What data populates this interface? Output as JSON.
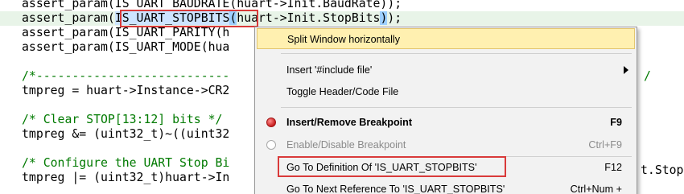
{
  "editor": {
    "lines": [
      {
        "pre": "assert_param(IS_UART_BAUDRATE(huart->Init.BaudRate));",
        "ident": "",
        "post": "",
        "type": "code"
      },
      {
        "pre": "assert_param(",
        "ident": "IS_UART_STOPBITS",
        "paren": "(",
        "post": "huart->Init.StopBits",
        "tail": ");",
        "type": "current"
      },
      {
        "pre": "assert_param(IS_UART_PARITY(h",
        "ident": "",
        "post": "",
        "type": "code"
      },
      {
        "pre": "assert_param(IS_UART_MODE(hua",
        "ident": "",
        "post": "",
        "type": "code"
      },
      {
        "pre": "",
        "ident": "",
        "post": "",
        "type": "code"
      },
      {
        "pre": "/*--------------------------- ",
        "ident": "",
        "post": "",
        "type": "comment"
      },
      {
        "pre": "tmpreg = huart->Instance->CR2",
        "ident": "",
        "post": "",
        "type": "code"
      },
      {
        "pre": "",
        "ident": "",
        "post": "",
        "type": "code"
      },
      {
        "pre": "/* Clear STOP[13:12] bits */",
        "ident": "",
        "post": "",
        "type": "comment"
      },
      {
        "pre": "tmpreg &= (uint32_t)~((uint32",
        "ident": "",
        "post": "",
        "type": "code"
      },
      {
        "pre": "",
        "ident": "",
        "post": "",
        "type": "code"
      },
      {
        "pre": "/* Configure the UART Stop Bi",
        "ident": "",
        "post": "",
        "type": "comment"
      },
      {
        "pre": "tmpreg |= (uint32_t)huart->In",
        "ident": "",
        "post": "",
        "type": "code"
      }
    ],
    "right_tails": [
      {
        "text": "/",
        "type": "comment"
      },
      {
        "text": "t.Stop",
        "type": "code"
      }
    ]
  },
  "context_menu": {
    "items": [
      {
        "label": "Split Window horizontally",
        "shortcut": "",
        "state": "highlighted"
      },
      {
        "label": "Insert '#include file'",
        "shortcut": "",
        "submenu": true
      },
      {
        "label": "Toggle Header/Code File",
        "shortcut": ""
      },
      {
        "label": "Insert/Remove Breakpoint",
        "shortcut": "F9",
        "icon": "breakpoint-active-icon",
        "bold": true
      },
      {
        "label": "Enable/Disable Breakpoint",
        "shortcut": "Ctrl+F9",
        "icon": "breakpoint-disabled-icon",
        "disabled": true
      },
      {
        "label": "Go To Definition Of 'IS_UART_STOPBITS'",
        "shortcut": "F12"
      },
      {
        "label": "Go To Next Reference To 'IS_UART_STOPBITS'",
        "shortcut": "Ctrl+Num +"
      }
    ]
  },
  "colors": {
    "annotation_red": "#d93a3a",
    "menu_highlight": "#fff0b0",
    "comment_green": "#007a00",
    "current_line_bg": "#e8f4e8"
  }
}
